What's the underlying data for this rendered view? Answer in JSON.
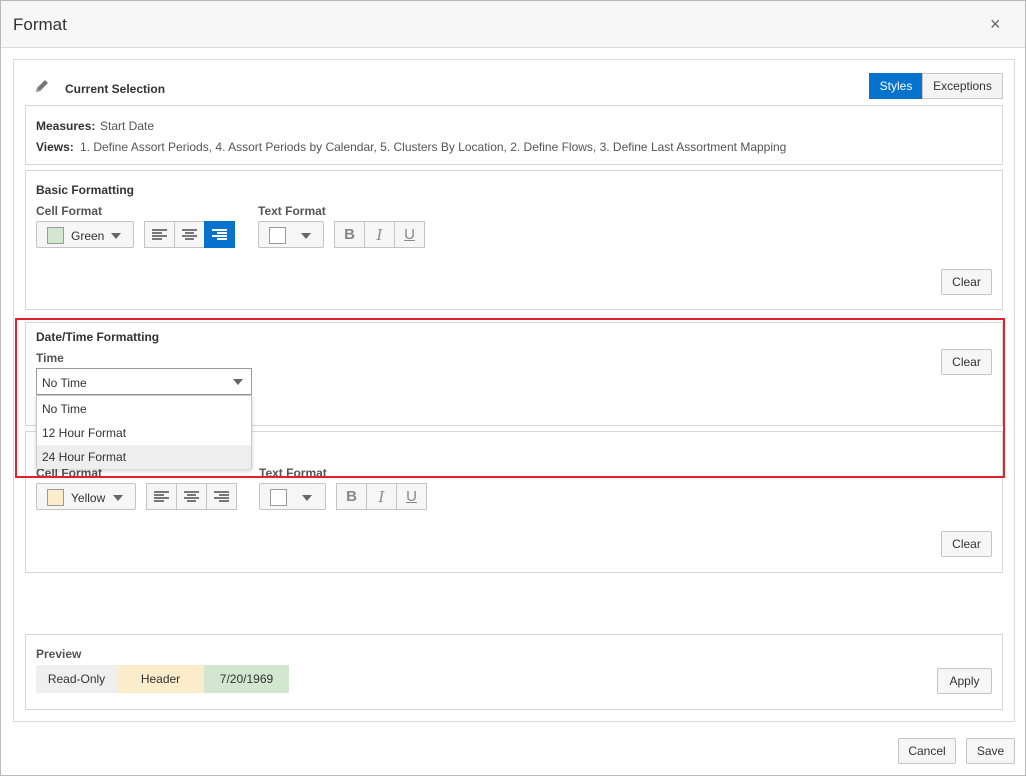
{
  "dialog": {
    "title": "Format",
    "close_glyph": "×"
  },
  "current_selection": {
    "title": "Current Selection",
    "icon": "pencil-icon",
    "tabs": [
      {
        "label": "Styles",
        "active": true
      },
      {
        "label": "Exceptions",
        "active": false
      }
    ],
    "measures_label": "Measures:",
    "measures_value": "Start Date",
    "views_label": "Views:",
    "views_value": "1. Define Assort Periods, 4. Assort Periods by Calendar, 5. Clusters By Location, 2. Define Flows, 3. Define Last Assortment Mapping"
  },
  "basic_formatting": {
    "title": "Basic Formatting",
    "cell_format_label": "Cell Format",
    "cell_color": {
      "label": "Green",
      "swatch": "#d3e6d0"
    },
    "alignment_active": "right",
    "text_format_label": "Text Format",
    "text_color_swatch": "#ffffff",
    "bold_label": "B",
    "italic_label": "I",
    "underline_label": "U",
    "clear_label": "Clear"
  },
  "date_time_formatting": {
    "title": "Date/Time Formatting",
    "time_label": "Time",
    "selected": "No Time",
    "options": [
      "No Time",
      "12 Hour Format",
      "24 Hour Format"
    ],
    "highlighted_option": "24 Hour Format",
    "clear_label": "Clear"
  },
  "second_formatting": {
    "cell_format_label": "Cell Format",
    "cell_color": {
      "label": "Yellow",
      "swatch": "#fbeccb"
    },
    "text_format_label": "Text Format",
    "text_color_swatch": "#ffffff",
    "bold_label": "B",
    "italic_label": "I",
    "underline_label": "U",
    "clear_label": "Clear"
  },
  "preview": {
    "title": "Preview",
    "cells": [
      {
        "label": "Read-Only",
        "bg": "#efefef"
      },
      {
        "label": "Header",
        "bg": "#fbeccb"
      },
      {
        "label": "7/20/1969",
        "bg": "#d3e6d0"
      }
    ],
    "apply_label": "Apply"
  },
  "footer": {
    "cancel_label": "Cancel",
    "save_label": "Save"
  },
  "colors": {
    "accent": "#0572ce",
    "highlight_border": "#e0232b"
  }
}
